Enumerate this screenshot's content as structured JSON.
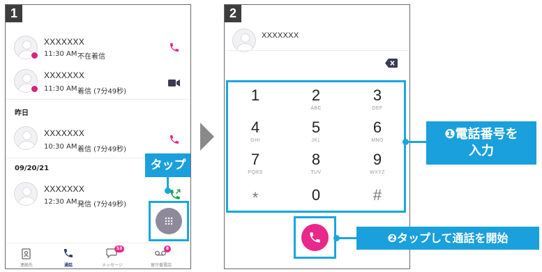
{
  "panel1": {
    "step": "1",
    "calls": [
      {
        "name": "XXXXXXX",
        "time": "11:30 AM",
        "status": "不在着信",
        "icon": "phone-icon"
      },
      {
        "name": "XXXXXXX",
        "time": "11:30 AM",
        "status": "着信 (7分49秒)",
        "icon": "video-icon"
      },
      {
        "name": "XXXXXXX",
        "time": "10:30 AM",
        "status": "着信 (7分49秒)",
        "icon": "phone-icon"
      },
      {
        "name": "XXXXXXX",
        "time": "12:30 AM",
        "status": "発信 (7分49秒)",
        "icon": "outgoing-call-icon"
      }
    ],
    "sections": [
      "昨日",
      "09/20/21"
    ],
    "tap_label": "タップ",
    "nav": [
      {
        "label": "連絡先",
        "icon": "contacts-icon",
        "badge": ""
      },
      {
        "label": "通話",
        "icon": "phone-icon",
        "badge": ""
      },
      {
        "label": "メッセージ",
        "icon": "message-icon",
        "badge": "53"
      },
      {
        "label": "留守番電話",
        "icon": "voicemail-icon",
        "badge": "8"
      }
    ]
  },
  "panel2": {
    "step": "2",
    "contact_name": "XXXXXXX",
    "keys": [
      {
        "num": "1",
        "letters": ""
      },
      {
        "num": "2",
        "letters": "ABC"
      },
      {
        "num": "3",
        "letters": "DEF"
      },
      {
        "num": "4",
        "letters": "GHI"
      },
      {
        "num": "5",
        "letters": "JKL"
      },
      {
        "num": "6",
        "letters": "MNO"
      },
      {
        "num": "7",
        "letters": "PQRS"
      },
      {
        "num": "8",
        "letters": "TUV"
      },
      {
        "num": "9",
        "letters": "WXYZ"
      },
      {
        "num": "*",
        "letters": ""
      },
      {
        "num": "0",
        "letters": ""
      },
      {
        "num": "#",
        "letters": ""
      }
    ]
  },
  "callouts": {
    "enter_number_line1": "❶電話番号を",
    "enter_number_line2": "入力",
    "tap_to_call": "❷タップして通話を開始"
  },
  "colors": {
    "accent": "#e8288a",
    "callout": "#19a6df",
    "green": "#1aa34a"
  }
}
